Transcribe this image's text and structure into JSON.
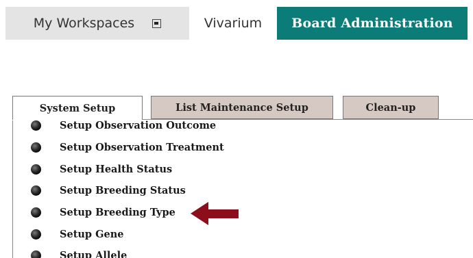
{
  "topnav": {
    "workspaces": "My Workspaces",
    "vivarium": "Vivarium",
    "board_admin": "Board Administration",
    "board_admin_color": "#0b7c78"
  },
  "tabs": [
    {
      "label": "System Setup",
      "active": true
    },
    {
      "label": "List Maintenance Setup",
      "active": false
    },
    {
      "label": "Clean-up",
      "active": false
    }
  ],
  "menu": {
    "items": [
      {
        "label": "Setup Observation Outcome"
      },
      {
        "label": "Setup Observation Treatment"
      },
      {
        "label": "Setup Health Status"
      },
      {
        "label": "Setup Breeding Status"
      },
      {
        "label": "Setup Breeding Type"
      },
      {
        "label": "Setup Gene"
      },
      {
        "label": "Setup Allele"
      }
    ]
  },
  "annotation": {
    "arrow_icon": "left-arrow-icon",
    "arrow_color": "#8b0e1a",
    "points_to": "Setup Breeding Type"
  }
}
